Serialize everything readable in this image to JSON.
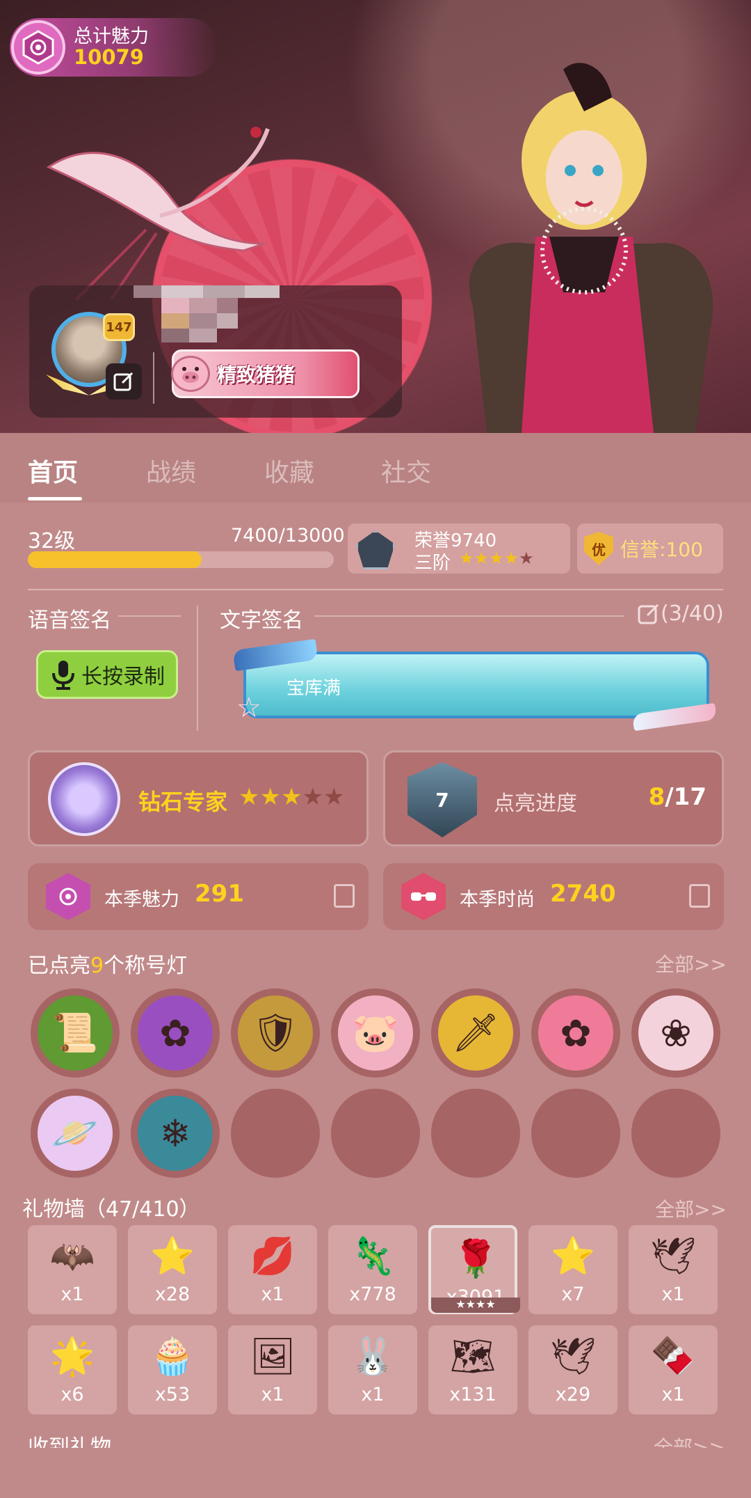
{
  "hero": {
    "charm_label": "总计魅力",
    "charm_value": "10079",
    "avatar_level": "147",
    "title_plate": "精致猪猪"
  },
  "tabs": [
    {
      "label": "首页",
      "active": true
    },
    {
      "label": "战绩",
      "active": false
    },
    {
      "label": "收藏",
      "active": false
    },
    {
      "label": "社交",
      "active": false
    }
  ],
  "level": {
    "label": "32级",
    "exp_text": "7400/13000",
    "progress": 0.569
  },
  "honor": {
    "text": "荣誉9740",
    "tier": "三阶",
    "stars_on": 4,
    "stars_total": 5
  },
  "credit": {
    "icon_text": "优",
    "text": "信誉:100"
  },
  "signature": {
    "voice_title": "语音签名",
    "record_button": "长按录制",
    "text_title": "文字签名",
    "text_count": "(3/40)",
    "text_value": "宝库满"
  },
  "rank": {
    "name": "钻石专家",
    "stars_on": 3,
    "stars_total": 5,
    "light_label": "点亮进度",
    "light_current": "8",
    "light_total": "/17",
    "light_emblem_number": "7"
  },
  "season": {
    "charm_label": "本季魅力",
    "charm_value": "291",
    "fashion_label": "本季时尚",
    "fashion_value": "2740"
  },
  "title_lights": {
    "prefix": "已点亮",
    "count": "9",
    "suffix": "个称号灯",
    "all_link": "全部>>",
    "items": [
      {
        "icon": "green-scroll-icon",
        "color": "#5f9a32",
        "glyph": "📜"
      },
      {
        "icon": "purple-seal-icon",
        "color": "#9a4fc0",
        "glyph": "✿"
      },
      {
        "icon": "shield-sword-icon",
        "color": "#c59a3c",
        "glyph": "🛡"
      },
      {
        "icon": "pig-icon",
        "color": "#f2b0c3",
        "glyph": "🐷"
      },
      {
        "icon": "dagger-icon",
        "color": "#e6b735",
        "glyph": "🗡"
      },
      {
        "icon": "pink-flower-icon",
        "color": "#f07b99",
        "glyph": "✿"
      },
      {
        "icon": "white-rose-icon",
        "color": "#f4d2dc",
        "glyph": "❀"
      },
      {
        "icon": "planet-icon",
        "color": "#eac9f2",
        "glyph": "🪐"
      },
      {
        "icon": "ice-crystal-icon",
        "color": "#3a8a9a",
        "glyph": "❄"
      }
    ],
    "empty_slots": 5
  },
  "gift_wall": {
    "title": "礼物墙（47/410）",
    "all_link": "全部>>",
    "items": [
      {
        "icon": "bat-crest-icon",
        "glyph": "🦇",
        "count": "x1"
      },
      {
        "icon": "gold-star-crest-icon",
        "glyph": "⭐",
        "count": "x28"
      },
      {
        "icon": "lips-icon",
        "glyph": "💋",
        "count": "x1"
      },
      {
        "icon": "golden-pet-icon",
        "glyph": "🦎",
        "count": "x778"
      },
      {
        "icon": "rose-icon",
        "glyph": "🌹",
        "count": "x3091",
        "selected": true,
        "stars": "★★★★"
      },
      {
        "icon": "sheriff-badge-icon",
        "glyph": "⭐",
        "count": "x7"
      },
      {
        "icon": "silver-bird-icon",
        "glyph": "🕊",
        "count": "x1"
      },
      {
        "icon": "purple-star-icon",
        "glyph": "🌟",
        "count": "x6"
      },
      {
        "icon": "cupcake-icon",
        "glyph": "🧁",
        "count": "x53"
      },
      {
        "icon": "photo-frame-icon",
        "glyph": "🖼",
        "count": "x1"
      },
      {
        "icon": "bunny-icon",
        "glyph": "🐰",
        "count": "x1"
      },
      {
        "icon": "treasure-map-icon",
        "glyph": "🗺",
        "count": "x131"
      },
      {
        "icon": "paper-crane-icon",
        "glyph": "🕊",
        "count": "x29"
      },
      {
        "icon": "chocolate-heart-icon",
        "glyph": "🍫",
        "count": "x1"
      }
    ]
  },
  "received_gifts": {
    "title": "收到礼物",
    "all_link": "全部>>"
  },
  "colors": {
    "panel": "#c18a8a",
    "accent_gold": "#ffd21e",
    "bar_fill": "#f7c12c"
  }
}
